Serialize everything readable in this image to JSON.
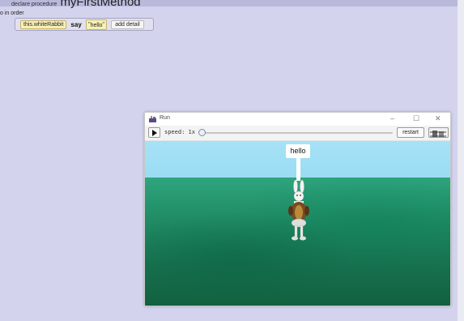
{
  "editor": {
    "procedure_keyword": "declare procedure",
    "procedure_name": "myFirstMethod",
    "do_in_order": "o in order",
    "statement": {
      "target": "this.whiteRabbit",
      "method": "say",
      "argument": "hello",
      "add_detail": "add detail"
    }
  },
  "run_window": {
    "title": "Run",
    "speed_label": "speed: 1x",
    "speed_value": 1,
    "restart_label": "restart",
    "scene": {
      "speech_text": "hello"
    }
  },
  "colors": {
    "editor_bg": "#d3d3ed",
    "sky": "#a6e2f7",
    "grass": "#1f8a63",
    "chip_yellow": "#f7f0b5"
  }
}
